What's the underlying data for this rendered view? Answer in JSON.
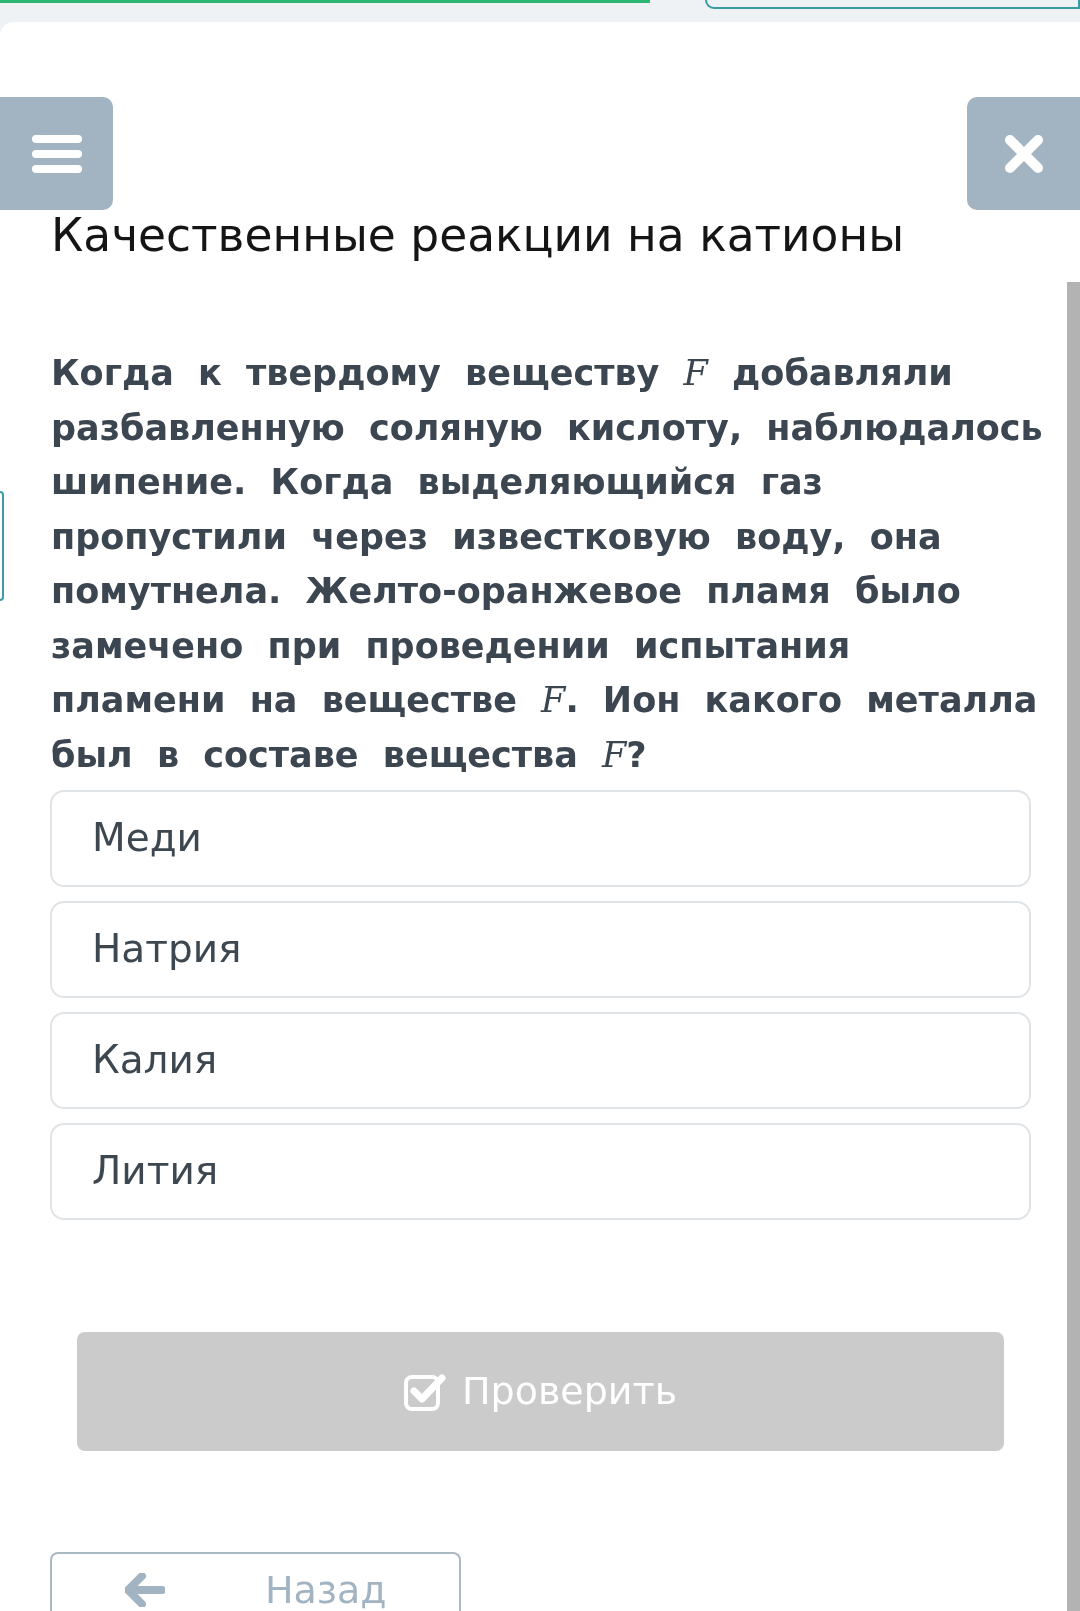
{
  "title": "Качественные реакции на катионы",
  "question": "Когда к твердому веществу *F* добавляли разбавленную соляную кислоту, наблюдалось шипение. Когда выделяющийся газ пропустили через известковую воду, она помутнела. Желто-оранжевое пламя было замечено при проведении испытания пламени на веществе *F*. Ион какого металла был в составе вещества *F*?",
  "options": [
    {
      "label": "Меди",
      "selected": false
    },
    {
      "label": "Натрия",
      "selected": false
    },
    {
      "label": "Калия",
      "selected": false
    },
    {
      "label": "Лития",
      "selected": false
    }
  ],
  "check_button": {
    "label": "Проверить",
    "disabled": true
  },
  "back_button": {
    "label": "Назад"
  }
}
